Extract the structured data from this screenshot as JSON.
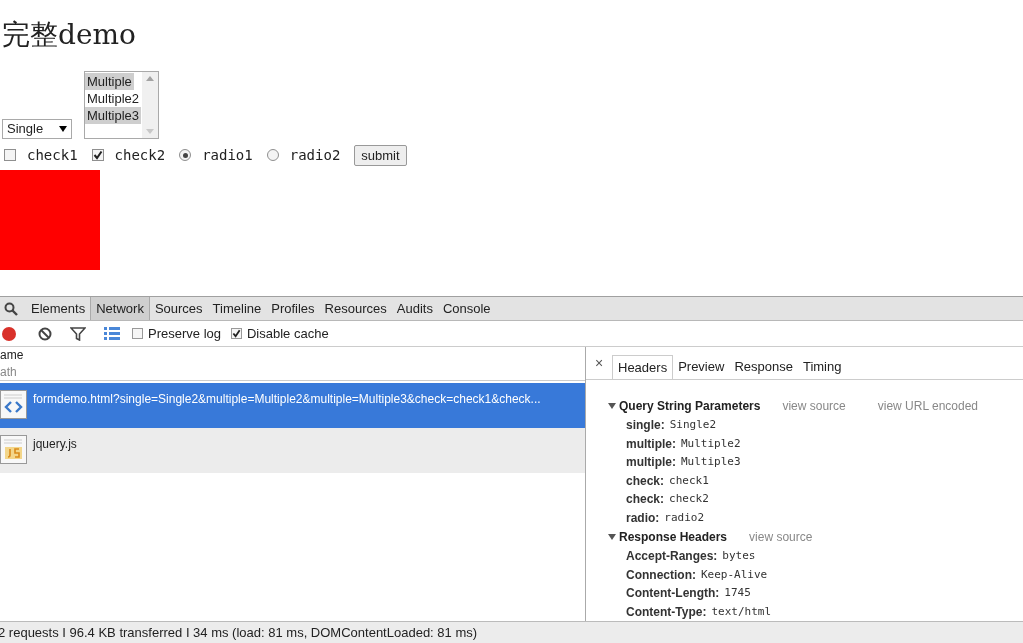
{
  "page": {
    "heading": "完整demo",
    "single_select": {
      "value": "Single"
    },
    "multi_select": {
      "options": [
        {
          "label": "Multiple",
          "selected": true
        },
        {
          "label": "Multiple2",
          "selected": false
        },
        {
          "label": "Multiple3",
          "selected": true
        }
      ]
    },
    "inputs": [
      {
        "kind": "checkbox",
        "label": "check1",
        "checked": false
      },
      {
        "kind": "checkbox",
        "label": "check2",
        "checked": true
      },
      {
        "kind": "radio",
        "label": "radio1",
        "checked": true
      },
      {
        "kind": "radio",
        "label": "radio2",
        "checked": false
      }
    ],
    "submit": "submit"
  },
  "devtools": {
    "tabs": [
      {
        "label": "Elements",
        "selected": false
      },
      {
        "label": "Network",
        "selected": true
      },
      {
        "label": "Sources",
        "selected": false
      },
      {
        "label": "Timeline",
        "selected": false
      },
      {
        "label": "Profiles",
        "selected": false
      },
      {
        "label": "Resources",
        "selected": false
      },
      {
        "label": "Audits",
        "selected": false
      },
      {
        "label": "Console",
        "selected": false
      }
    ],
    "options": [
      {
        "label": "Preserve log",
        "checked": false
      },
      {
        "label": "Disable cache",
        "checked": true
      }
    ],
    "columns": {
      "name": "ame",
      "path": "ath"
    },
    "requests": [
      {
        "name": "formdemo.html?single=Single2&multiple=Multiple2&multiple=Multiple3&check=check1&check...",
        "kind": "html",
        "selected": true
      },
      {
        "name": "jquery.js",
        "kind": "js",
        "selected": false
      }
    ],
    "close": "×",
    "detail_tabs": [
      {
        "label": "Headers",
        "selected": true
      },
      {
        "label": "Preview",
        "selected": false
      },
      {
        "label": "Response",
        "selected": false
      },
      {
        "label": "Timing",
        "selected": false
      }
    ],
    "sections": [
      {
        "title": "Query String Parameters",
        "expanded": true,
        "links": [
          "view source",
          "view URL encoded"
        ],
        "rows": [
          {
            "key": "single:",
            "value": "Single2"
          },
          {
            "key": "multiple:",
            "value": "Multiple2"
          },
          {
            "key": "multiple:",
            "value": "Multiple3"
          },
          {
            "key": "check:",
            "value": "check1"
          },
          {
            "key": "check:",
            "value": "check2"
          },
          {
            "key": "radio:",
            "value": "radio2"
          }
        ]
      },
      {
        "title": "Response Headers",
        "expanded": true,
        "links": [
          "view source"
        ],
        "rows": [
          {
            "key": "Accept-Ranges:",
            "value": "bytes"
          },
          {
            "key": "Connection:",
            "value": "Keep-Alive"
          },
          {
            "key": "Content-Length:",
            "value": "1745"
          },
          {
            "key": "Content-Type:",
            "value": "text/html"
          }
        ]
      }
    ],
    "status_bar": "2 requests I 96.4 KB transferred I 34 ms (load: 81 ms, DOMContentLoaded: 81 ms)"
  }
}
